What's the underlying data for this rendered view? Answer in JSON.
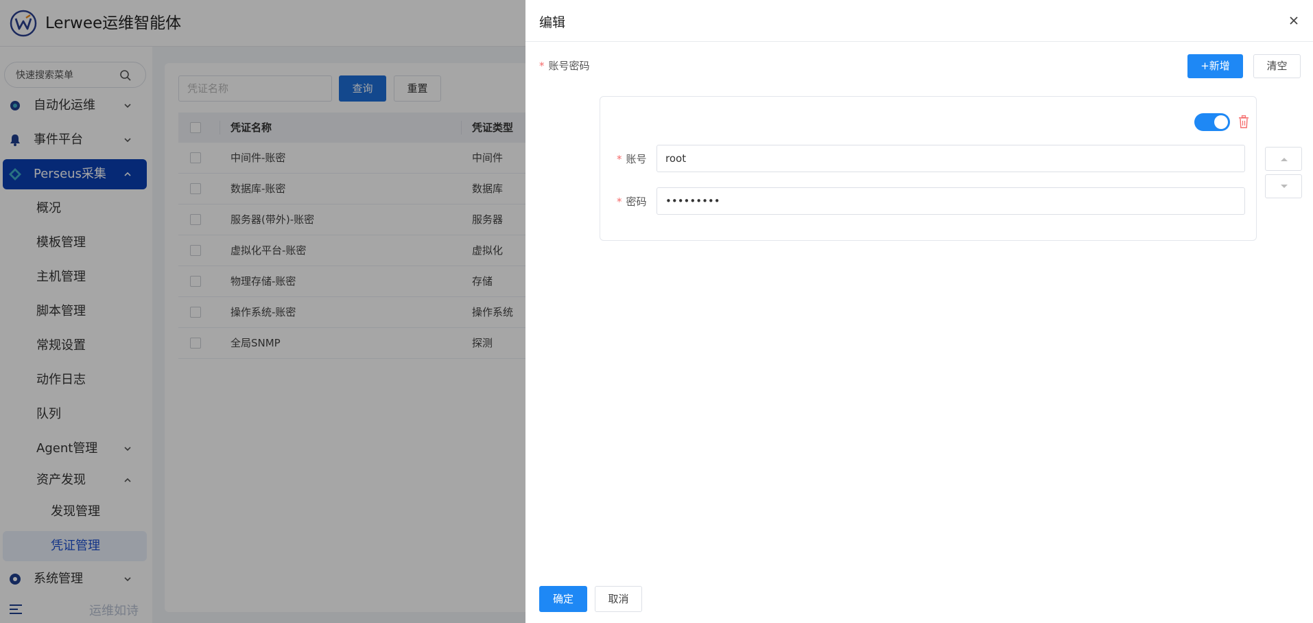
{
  "app": {
    "brand": "Lerwee运维智能体",
    "slogan": "运维如诗"
  },
  "search": {
    "placeholder": "快速搜索菜单"
  },
  "sidebar": {
    "menus": [
      {
        "label": "自动化运维",
        "icon": "gear-icon"
      },
      {
        "label": "事件平台",
        "icon": "bell-icon"
      },
      {
        "label": "Perseus采集",
        "icon": "perseus-icon"
      }
    ],
    "sub_items": [
      "概况",
      "模板管理",
      "主机管理",
      "脚本管理",
      "常规设置",
      "动作日志",
      "队列",
      "Agent管理",
      "资产发现"
    ],
    "lvl3_items": [
      "发现管理",
      "凭证管理"
    ],
    "system": {
      "label": "系统管理",
      "icon": "settings-icon"
    }
  },
  "filter": {
    "placeholder": "凭证名称",
    "query_label": "查询",
    "reset_label": "重置"
  },
  "table": {
    "headers": [
      "凭证名称",
      "凭证类型"
    ],
    "rows": [
      [
        "中间件-账密",
        "中间件"
      ],
      [
        "数据库-账密",
        "数据库"
      ],
      [
        "服务器(带外)-账密",
        "服务器"
      ],
      [
        "虚拟化平台-账密",
        "虚拟化"
      ],
      [
        "物理存储-账密",
        "存储"
      ],
      [
        "操作系统-账密",
        "操作系统"
      ],
      [
        "全局SNMP",
        "探测"
      ]
    ]
  },
  "drawer": {
    "title": "编辑",
    "field_label": "账号密码",
    "add_label": "+新增",
    "clear_label": "清空",
    "account_label": "账号",
    "account_value": "root",
    "password_label": "密码",
    "password_value": "rootpass1",
    "enabled": true,
    "ok_label": "确定",
    "cancel_label": "取消"
  },
  "colors": {
    "primary": "#1e88f5",
    "active_menu": "#0a3fb4",
    "required": "#f56c6c",
    "danger": "#f56c6c"
  }
}
